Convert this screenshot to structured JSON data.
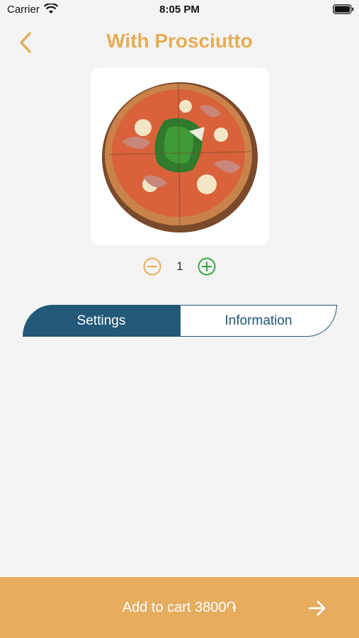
{
  "status_bar": {
    "carrier": "Carrier",
    "time": "8:05 PM"
  },
  "header": {
    "title": "With Prosciutto",
    "back_icon": "chevron-left-icon"
  },
  "product": {
    "image": "pizza-prosciutto-arugula"
  },
  "quantity": {
    "value": "1",
    "minus_icon": "minus-circle-icon",
    "plus_icon": "plus-circle-icon"
  },
  "tabs": [
    {
      "label": "Settings",
      "active": true
    },
    {
      "label": "Information",
      "active": false
    }
  ],
  "cart": {
    "label": "Add to cart 3800֏",
    "arrow_icon": "arrow-right-icon"
  },
  "colors": {
    "accent": "#e6ad55",
    "tab_active": "#225878",
    "cart_bar": "#e6ad5f",
    "minus": "#e6ad55",
    "plus": "#3aa847",
    "background": "#f4f4f4"
  }
}
